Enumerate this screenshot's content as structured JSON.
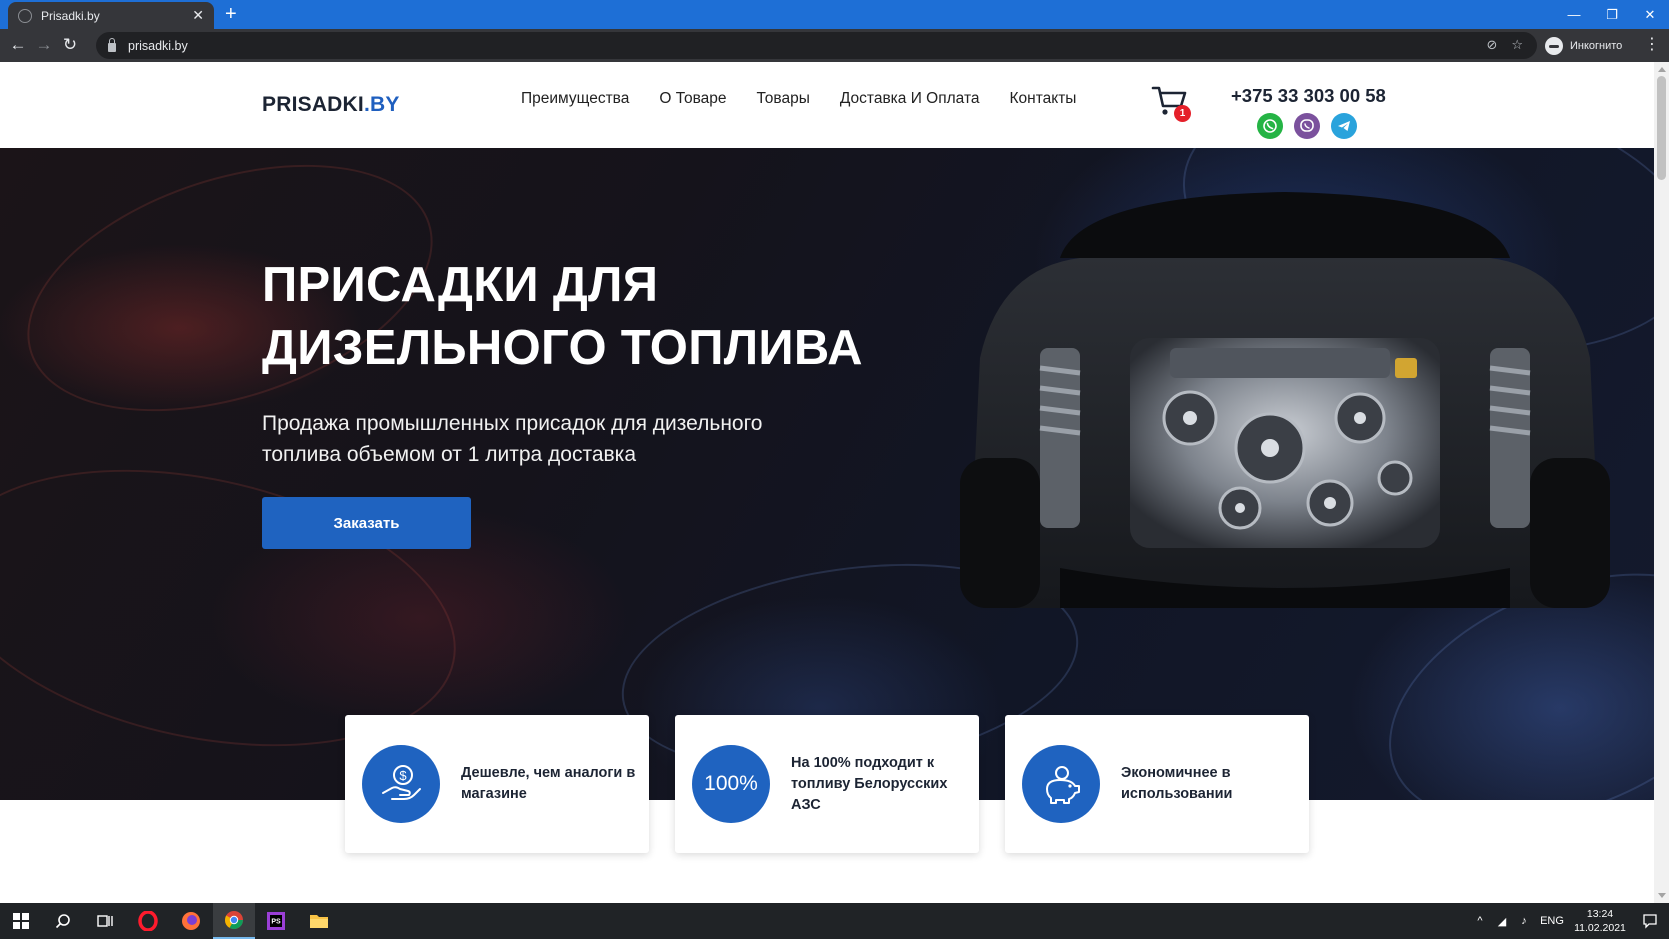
{
  "browser": {
    "tab_title": "Prisadki.by",
    "url": "prisadki.by",
    "profile_label": "Инкогнито"
  },
  "header": {
    "logo_main": "PRISADKI",
    "logo_accent": ".BY",
    "nav": [
      "Преимущества",
      "О Товаре",
      "Товары",
      "Доставка И Оплата",
      "Контакты"
    ],
    "cart_count": "1",
    "phone": "+375 33 303 00 58"
  },
  "hero": {
    "title": "ПРИСАДКИ ДЛЯ ДИЗЕЛЬНОГО ТОПЛИВА",
    "subtitle": "Продажа промышленных присадок для дизельного топлива объемом от 1 литра доставка",
    "order_button": "Заказать"
  },
  "features": [
    {
      "icon": "hand-coin-icon",
      "text": "Дешевле, чем аналоги в магазине"
    },
    {
      "icon": "percent-badge-icon",
      "badge": "100%",
      "text": "На 100% подходит к топливу Белорусских АЗС"
    },
    {
      "icon": "piggy-bank-icon",
      "text": "Экономичнее в использовании"
    }
  ],
  "taskbar": {
    "language": "ENG",
    "time": "13:24",
    "date": "11.02.2021"
  },
  "colors": {
    "brand_blue": "#1f63c0",
    "cart_badge": "#e5202a",
    "browser_titlebar": "#1e6fd6"
  }
}
